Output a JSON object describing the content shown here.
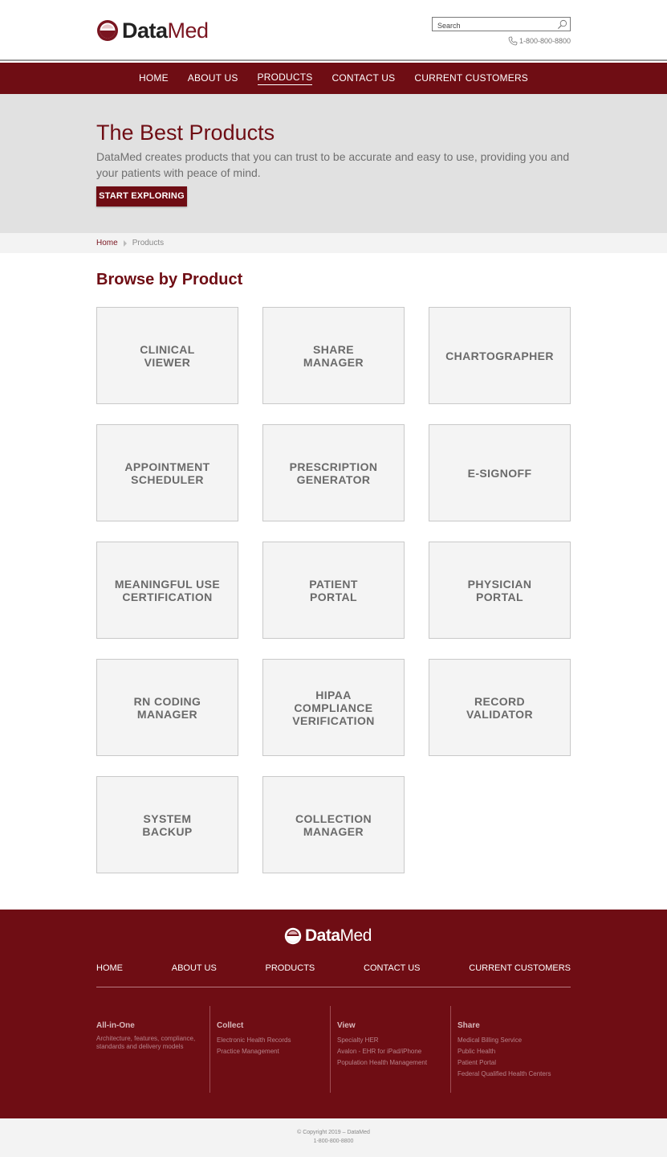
{
  "brand": {
    "part1": "Data",
    "part2": "Med",
    "accent": "#6f0d14"
  },
  "search": {
    "placeholder": "Search"
  },
  "phone": "1-800-800-8800",
  "nav": [
    {
      "label": "HOME",
      "active": false
    },
    {
      "label": "ABOUT US",
      "active": false
    },
    {
      "label": "PRODUCTS",
      "active": true
    },
    {
      "label": "CONTACT US",
      "active": false
    },
    {
      "label": "CURRENT CUSTOMERS",
      "active": false
    }
  ],
  "hero": {
    "title": "The Best Products",
    "description": "DataMed creates products that you can trust to be accurate and easy to use, providing you and your patients with peace of mind.",
    "button": "START EXPLORING"
  },
  "breadcrumb": {
    "home": "Home",
    "current": "Products"
  },
  "browse": {
    "title": "Browse by Product",
    "products": [
      "CLINICAL\nVIEWER",
      "SHARE\nMANAGER",
      "CHARTOGRAPHER",
      "APPOINTMENT\nSCHEDULER",
      "PRESCRIPTION\nGENERATOR",
      "E-SIGNOFF",
      "MEANINGFUL USE\nCERTIFICATION",
      "PATIENT\nPORTAL",
      "PHYSICIAN\nPORTAL",
      "RN CODING\nMANAGER",
      "HIPAA\nCOMPLIANCE\nVERIFICATION",
      "RECORD\nVALIDATOR",
      "SYSTEM\nBACKUP",
      "COLLECTION\nMANAGER"
    ]
  },
  "footer": {
    "nav": [
      "HOME",
      "ABOUT US",
      "PRODUCTS",
      "CONTACT US",
      "CURRENT CUSTOMERS"
    ],
    "columns": [
      {
        "title": "All-in-One",
        "description": "Architecture, features, compliance, standards and delivery models"
      },
      {
        "title": "Collect",
        "links": [
          "Electronic Health Records",
          "Practice Management"
        ]
      },
      {
        "title": "View",
        "links": [
          "Specialty HER",
          "Avalon - EHR for iPad/iPhone",
          "Population Health Management"
        ]
      },
      {
        "title": "Share",
        "links": [
          "Medical Billing Service",
          "Public Health",
          "Patient Portal",
          "Federal Qualified Health Centers"
        ]
      }
    ],
    "copyright": "© Copyright 2019 – DataMed",
    "phone": "1-800-800-8800"
  }
}
